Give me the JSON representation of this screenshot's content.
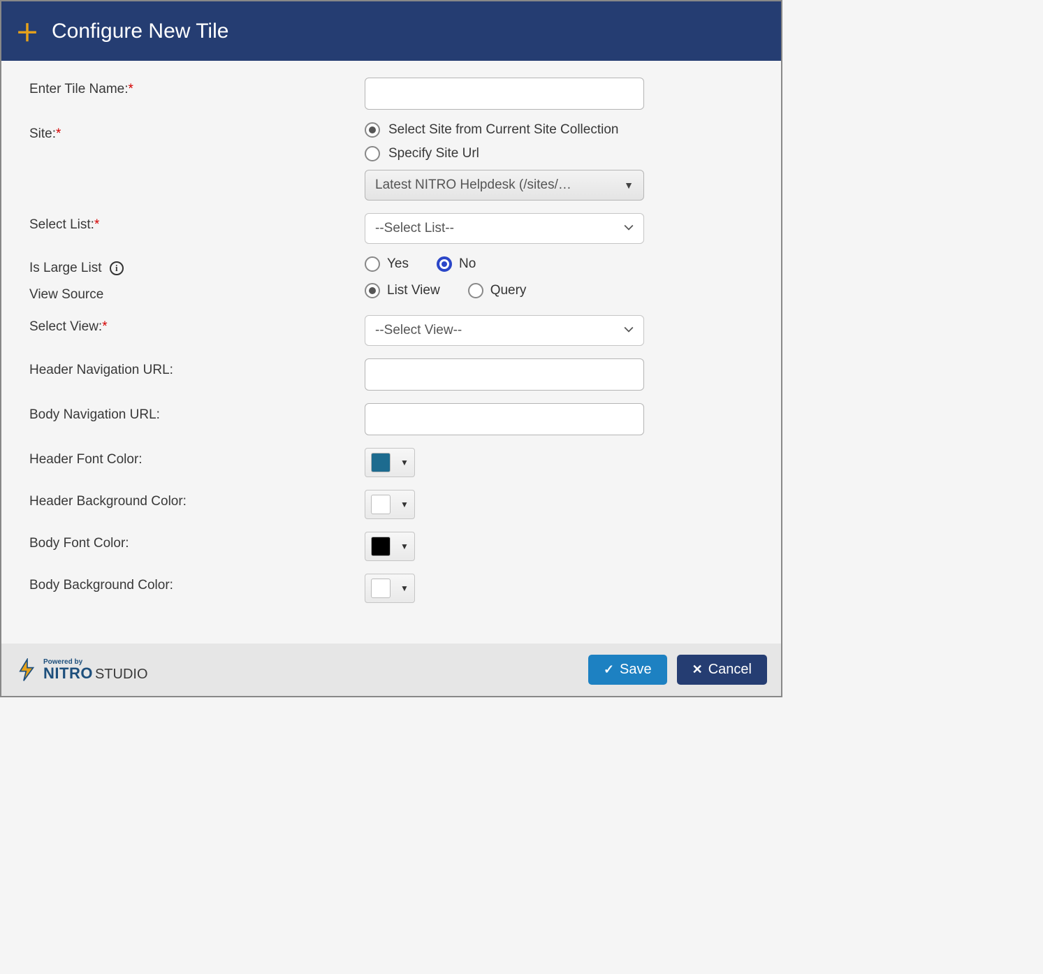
{
  "header": {
    "title": "Configure New Tile"
  },
  "form": {
    "tile_name": {
      "label": "Enter Tile Name:",
      "value": ""
    },
    "site": {
      "label": "Site:",
      "options": {
        "from_collection": "Select Site from Current Site Collection",
        "specify_url": "Specify Site Url"
      },
      "selected": "from_collection",
      "dropdown_value": "Latest NITRO Helpdesk (/sites/…"
    },
    "select_list": {
      "label": "Select List:",
      "value": "--Select List--"
    },
    "is_large_list": {
      "label": "Is Large List",
      "yes": "Yes",
      "no": "No",
      "selected": "no"
    },
    "view_source": {
      "label": "View Source",
      "list_view": "List View",
      "query": "Query",
      "selected": "list_view"
    },
    "select_view": {
      "label": "Select View:",
      "value": "--Select View--"
    },
    "header_nav_url": {
      "label": "Header Navigation URL:",
      "value": ""
    },
    "body_nav_url": {
      "label": "Body Navigation URL:",
      "value": ""
    },
    "header_font_color": {
      "label": "Header Font Color:",
      "value": "#1d6b8f"
    },
    "header_bg_color": {
      "label": "Header Background Color:",
      "value": "#ffffff"
    },
    "body_font_color": {
      "label": "Body Font Color:",
      "value": "#000000"
    },
    "body_bg_color": {
      "label": "Body Background Color:",
      "value": "#ffffff"
    }
  },
  "footer": {
    "powered_by": "Powered by",
    "brand": "NITRO",
    "brand_sub": "STUDIO",
    "save": "Save",
    "cancel": "Cancel"
  }
}
